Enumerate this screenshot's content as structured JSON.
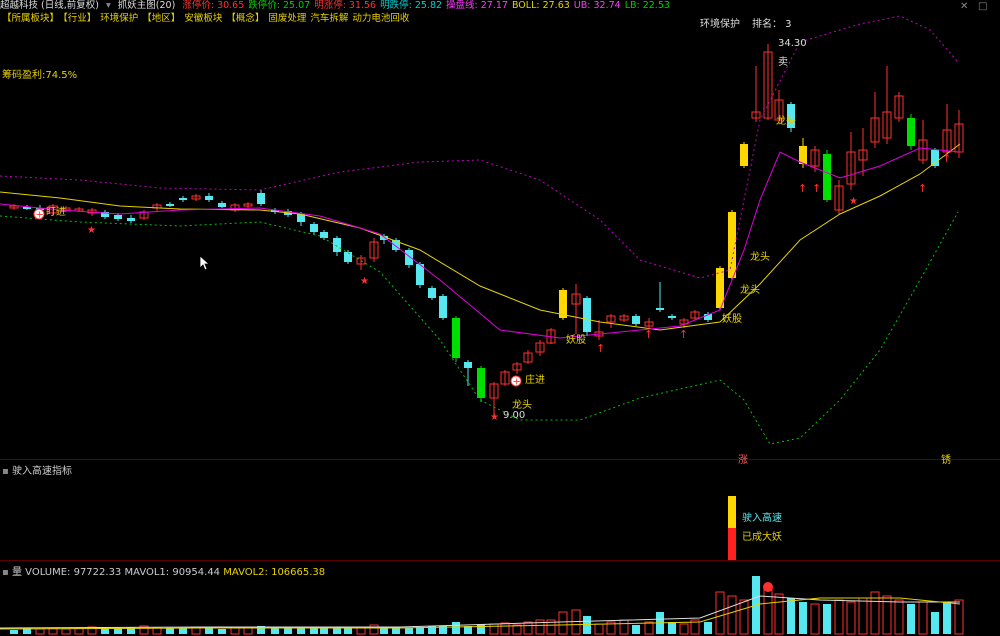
{
  "header": {
    "stock": "超越科技 (日线,前复权)",
    "indicator": "抓妖主图(20)",
    "fields": [
      {
        "label": "涨停价: 30.65",
        "color": "#ff3030"
      },
      {
        "label": "跌停价: 25.07",
        "color": "#00d000"
      },
      {
        "label": "明涨停: 31.56",
        "color": "#ff3030"
      },
      {
        "label": "明跌停: 25.82",
        "color": "#00d0d0"
      },
      {
        "label": "操盘线: 27.17",
        "color": "#ff3cff"
      },
      {
        "label": "BOLL: 27.63",
        "color": "#e8d200"
      },
      {
        "label": "UB: 32.74",
        "color": "#ff3cff"
      },
      {
        "label": "LB: 22.53",
        "color": "#00d000"
      }
    ]
  },
  "tags": [
    "【所属板块】",
    "【行业】",
    "环境保护",
    "【地区】",
    "安徽板块",
    "【概念】",
    "固废处理",
    "汽车拆解",
    "动力电池回收"
  ],
  "env": {
    "label": "环境保护",
    "rank": "排名： 3"
  },
  "chip": "筹码盈利:74.5%",
  "annotations": {
    "high": "34.30",
    "sell": "卖",
    "low": "9.00",
    "zhuangjin": "庄进",
    "dingzhi": "盯进",
    "longtou": "龙头",
    "yaogu": "妖股",
    "zhang": "涨",
    "xiu": "锈"
  },
  "panel2": {
    "title": "驶入高速指标",
    "label1": "驶入高速",
    "label2": "已成大妖"
  },
  "panel3": {
    "title": "量",
    "volume": "VOLUME: 97722.33",
    "mavol1": "MAVOL1: 90954.44",
    "mavol2": "MAVOL2: 106665.38"
  },
  "colors": {
    "up": "#ff3030",
    "down": "#55e8f0",
    "yellow": "#ffd700",
    "green": "#00e000",
    "boll": "#e8d200",
    "ma": "#e000e0"
  }
}
